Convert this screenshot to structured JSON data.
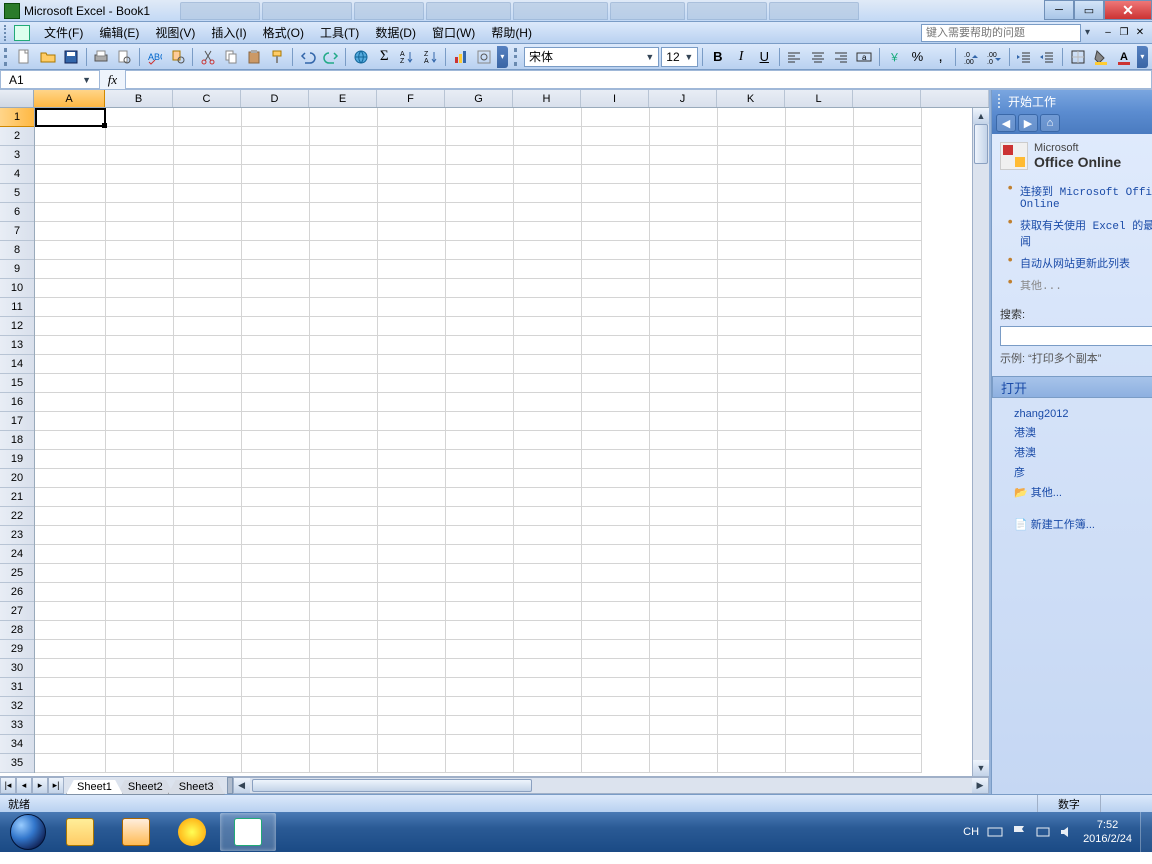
{
  "title": "Microsoft Excel - Book1",
  "menu": {
    "file": "文件(F)",
    "edit": "编辑(E)",
    "view": "视图(V)",
    "insert": "插入(I)",
    "format": "格式(O)",
    "tools": "工具(T)",
    "data": "数据(D)",
    "window": "窗口(W)",
    "help": "帮助(H)"
  },
  "help_placeholder": "键入需要帮助的问题",
  "format_toolbar": {
    "font_name": "宋体",
    "font_size": "12"
  },
  "namebox": "A1",
  "columns": [
    "A",
    "B",
    "C",
    "D",
    "E",
    "F",
    "G",
    "H",
    "I",
    "J",
    "K",
    "L"
  ],
  "row_count": 35,
  "sheet_tabs": {
    "s1": "Sheet1",
    "s2": "Sheet2",
    "s3": "Sheet3"
  },
  "status": {
    "ready": "就绪",
    "mode": "数字"
  },
  "taskpane": {
    "title": "开始工作",
    "office_small": "Microsoft",
    "office_big": "Office Online",
    "links": {
      "connect": "连接到 Microsoft Office Online",
      "news": "获取有关使用 Excel 的最新新闻",
      "autoupdate": "自动从网站更新此列表",
      "other": "其他..."
    },
    "search_label": "搜索:",
    "example": "示例: “打印多个副本”",
    "open_header": "打开",
    "recent": {
      "r1": "zhang2012",
      "r2": "港澳",
      "r3": "港澳",
      "r4": "彦"
    },
    "other_open": "其他...",
    "new_wb": "新建工作簿..."
  },
  "tray": {
    "ime": "CH",
    "time": "7:52",
    "date": "2016/2/24"
  }
}
